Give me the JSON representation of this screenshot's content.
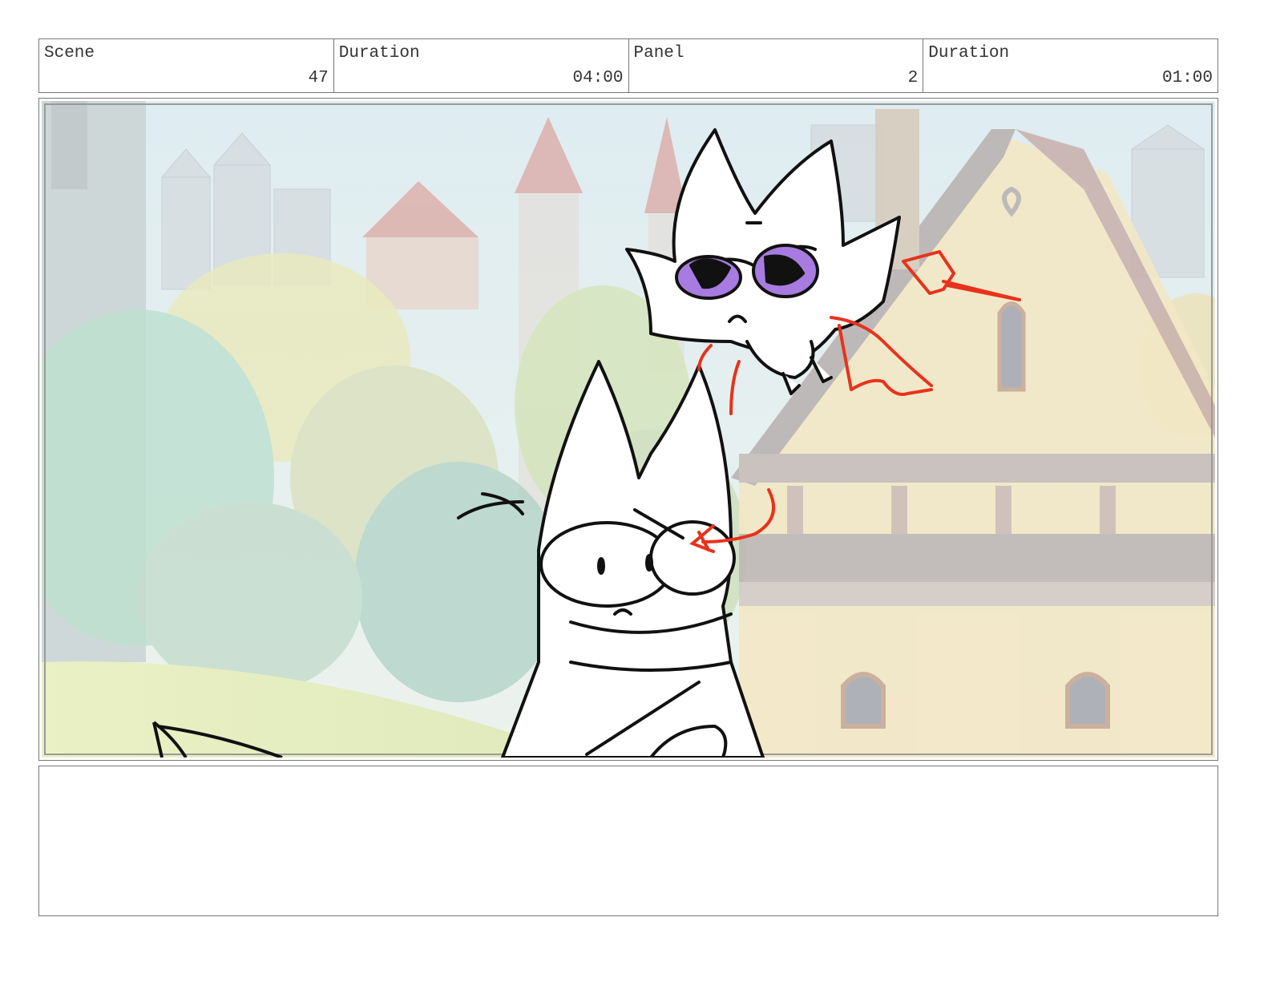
{
  "header": {
    "scene_label": "Scene",
    "scene_value": "47",
    "scene_duration_label": "Duration",
    "scene_duration_value": "04:00",
    "panel_label": "Panel",
    "panel_value": "2",
    "panel_duration_label": "Duration",
    "panel_duration_value": "01:00"
  },
  "notes": {
    "text": ""
  },
  "colors": {
    "sketch_line": "#111111",
    "annotation_red": "#e8321c",
    "eye_purple": "#a77be0"
  }
}
